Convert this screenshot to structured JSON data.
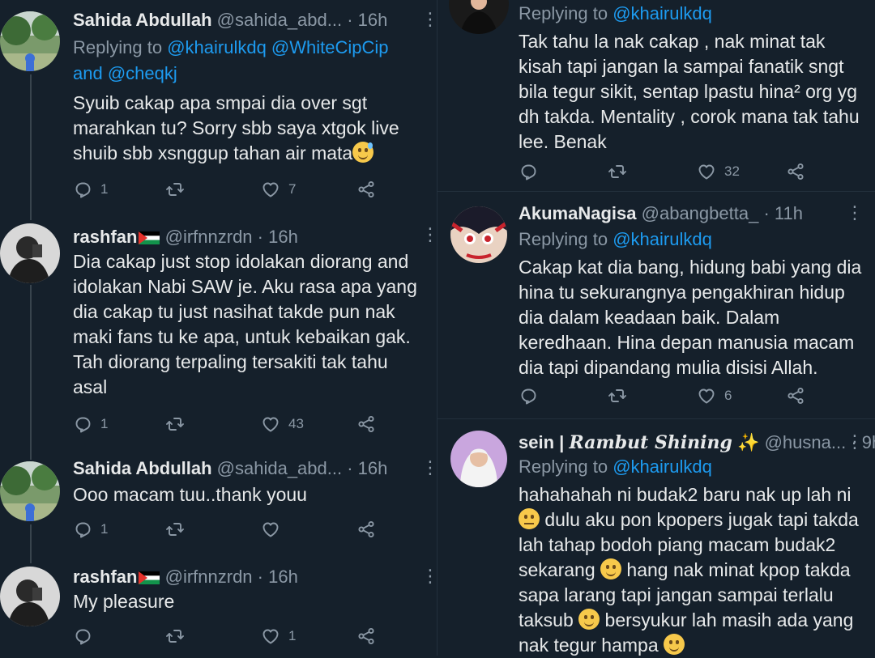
{
  "left_column": {
    "tweets": [
      {
        "name": "Sahida Abdullah",
        "handle": "@sahida_abd...",
        "time": "· 16h",
        "replying_to_prefix": "Replying to",
        "replying_to_mentions_1": "@khairulkdq @WhiteCipCip",
        "replying_to_and": "and",
        "replying_to_mentions_2": "@cheqkj",
        "text_lines": [
          "Syuib cakap apa smpai dia over sgt",
          "marahkan tu? Sorry sbb saya xtgok live",
          "shuib sbb xsnggup tahan air mata"
        ],
        "emoji": "sweat-smile-emoji",
        "replies": "1",
        "retweets": "",
        "likes": "7"
      },
      {
        "name": "rashfan",
        "flag": "palestine-flag-emoji",
        "handle": "@irfnnzrdn",
        "time": "· 16h",
        "text_lines": [
          "Dia cakap just stop idolakan diorang and",
          "idolakan Nabi SAW je. Aku rasa apa yang",
          "dia cakap tu just nasihat takde pun nak",
          "maki fans tu ke apa, untuk kebaikan gak.",
          "Tah diorang terpaling tersakiti tak tahu",
          "asal"
        ],
        "replies": "1",
        "retweets": "",
        "likes": "43"
      },
      {
        "name": "Sahida Abdullah",
        "handle": "@sahida_abd...",
        "time": "· 16h",
        "text_lines": [
          "Ooo macam tuu..thank youu"
        ],
        "replies": "1",
        "retweets": "",
        "likes": ""
      },
      {
        "name": "rashfan",
        "flag": "palestine-flag-emoji",
        "handle": "@irfnnzrdn",
        "time": "· 16h",
        "text_lines": [
          "My pleasure"
        ],
        "replies": "",
        "retweets": "",
        "likes": "1"
      }
    ]
  },
  "right_column": {
    "tweets": [
      {
        "replying_to_prefix": "Replying to",
        "replying_to_mentions": "@khairulkdq",
        "text_lines": [
          "Tak tahu la nak cakap , nak minat tak",
          "kisah tapi jangan la sampai fanatik sngt",
          "bila tegur sikit, sentap lpastu hina² org yg",
          "dh takda. Mentality , corok mana tak tahu",
          "lee. Benak"
        ],
        "replies": "",
        "retweets": "",
        "likes": "32"
      },
      {
        "name": "AkumaNagisa",
        "handle": "@abangbetta_",
        "time": "· 11h",
        "replying_to_prefix": "Replying to",
        "replying_to_mentions": "@khairulkdq",
        "text_lines": [
          "Cakap kat dia bang, hidung babi yang dia",
          "hina tu sekurangnya pengakhiran hidup",
          "dia dalam keadaan baik. Dalam",
          "keredhaan. Hina depan manusia macam",
          "dia tapi dipandang mulia disisi Allah."
        ],
        "replies": "",
        "retweets": "",
        "likes": "6"
      },
      {
        "name": "sein |",
        "name_script": "Rambut Shining",
        "name_sparkle": "✨",
        "handle": "@husna...",
        "time": "· 9h",
        "replying_to_prefix": "Replying to",
        "replying_to_mentions": "@khairulkdq",
        "text_lines": [
          "hahahahah ni budak2 baru nak up lah ni",
          "dulu aku pon kpopers jugak tapi takda",
          "lah tahap bodoh piang macam budak2",
          "sekarang",
          "hang nak minat kpop takda",
          "sapa larang tapi jangan sampai terlalu",
          "taksub",
          "bersyukur lah masih ada yang",
          "nak tegur hampa"
        ]
      }
    ]
  },
  "colors": {
    "background": "#15202b",
    "text": "#e7e9ea",
    "secondary": "#8b98a5",
    "accent": "#1d9bf0"
  }
}
